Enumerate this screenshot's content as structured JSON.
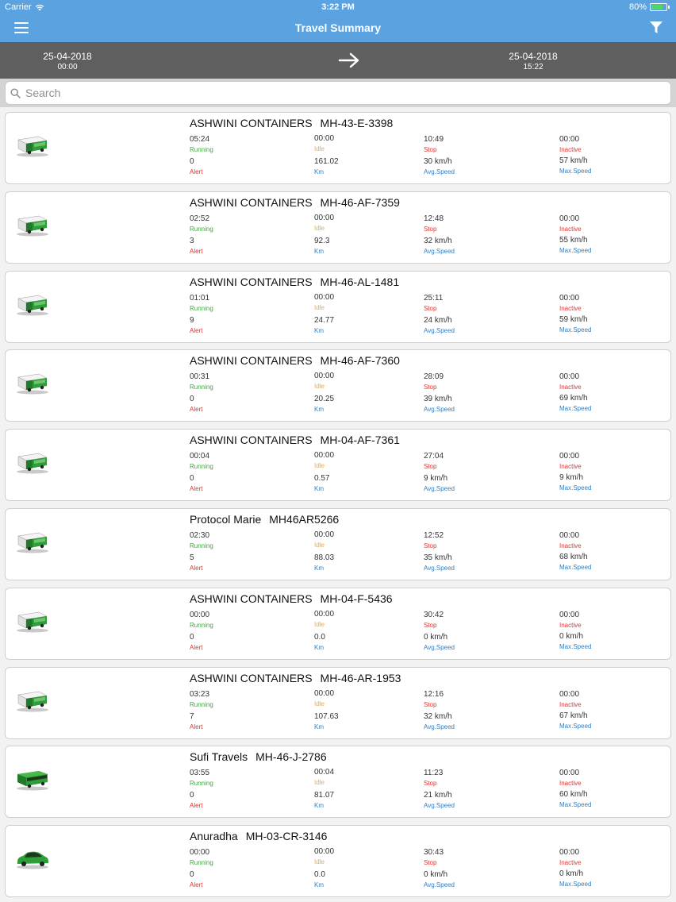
{
  "status": {
    "carrier": "Carrier",
    "time": "3:22 PM",
    "battery": "80%",
    "battery_level": 0.8
  },
  "nav": {
    "title": "Travel Summary",
    "menu_icon": "hamburger-icon",
    "filter_icon": "filter-icon"
  },
  "date_range": {
    "from_date": "25-04-2018",
    "from_time": "00:00",
    "to_date": "25-04-2018",
    "to_time": "15:22"
  },
  "search": {
    "placeholder": "Search"
  },
  "labels": {
    "running": "Running",
    "idle": "Idle",
    "stop": "Stop",
    "inactive": "Inactive",
    "alert": "Alert",
    "km": "Km",
    "avg": "Avg.Speed",
    "max": "Max.Speed"
  },
  "colors": {
    "header": "#5ba3e0",
    "date_bar": "#5f5f5f",
    "running": "#3ea83e",
    "idle": "#f0a92e",
    "stop": "#e3342f",
    "info": "#2e7fc5"
  },
  "vehicles": [
    {
      "name": "ASHWINI CONTAINERS",
      "reg": "MH-43-E-3398",
      "type": "truck",
      "running": "05:24",
      "idle": "00:00",
      "stop": "10:49",
      "inactive": "00:00",
      "alert": "0",
      "km": "161.02",
      "avg": "30 km/h",
      "max": "57 km/h"
    },
    {
      "name": "ASHWINI CONTAINERS",
      "reg": "MH-46-AF-7359",
      "type": "truck",
      "running": "02:52",
      "idle": "00:00",
      "stop": "12:48",
      "inactive": "00:00",
      "alert": "3",
      "km": "92.3",
      "avg": "32 km/h",
      "max": "55 km/h"
    },
    {
      "name": "ASHWINI CONTAINERS",
      "reg": "MH-46-AL-1481",
      "type": "truck",
      "running": "01:01",
      "idle": "00:00",
      "stop": "25:11",
      "inactive": "00:00",
      "alert": "9",
      "km": "24.77",
      "avg": "24 km/h",
      "max": "59 km/h"
    },
    {
      "name": "ASHWINI CONTAINERS",
      "reg": "MH-46-AF-7360",
      "type": "truck",
      "running": "00:31",
      "idle": "00:00",
      "stop": "28:09",
      "inactive": "00:00",
      "alert": "0",
      "km": "20.25",
      "avg": "39 km/h",
      "max": "69 km/h"
    },
    {
      "name": "ASHWINI CONTAINERS",
      "reg": "MH-04-AF-7361",
      "type": "truck",
      "running": "00:04",
      "idle": "00:00",
      "stop": "27:04",
      "inactive": "00:00",
      "alert": "0",
      "km": "0.57",
      "avg": "9 km/h",
      "max": "9 km/h"
    },
    {
      "name": "Protocol Marie",
      "reg": "MH46AR5266",
      "type": "truck",
      "running": "02:30",
      "idle": "00:00",
      "stop": "12:52",
      "inactive": "00:00",
      "alert": "5",
      "km": "88.03",
      "avg": "35 km/h",
      "max": "68 km/h"
    },
    {
      "name": "ASHWINI CONTAINERS",
      "reg": "MH-04-F-5436",
      "type": "truck",
      "running": "00:00",
      "idle": "00:00",
      "stop": "30:42",
      "inactive": "00:00",
      "alert": "0",
      "km": "0.0",
      "avg": "0 km/h",
      "max": "0 km/h"
    },
    {
      "name": "ASHWINI CONTAINERS",
      "reg": "MH-46-AR-1953",
      "type": "truck",
      "running": "03:23",
      "idle": "00:00",
      "stop": "12:16",
      "inactive": "00:00",
      "alert": "7",
      "km": "107.63",
      "avg": "32 km/h",
      "max": "67 km/h"
    },
    {
      "name": "Sufi Travels",
      "reg": "MH-46-J-2786",
      "type": "bus",
      "running": "03:55",
      "idle": "00:04",
      "stop": "11:23",
      "inactive": "00:00",
      "alert": "0",
      "km": "81.07",
      "avg": "21 km/h",
      "max": "60 km/h"
    },
    {
      "name": "Anuradha",
      "reg": "MH-03-CR-3146",
      "type": "car",
      "running": "00:00",
      "idle": "00:00",
      "stop": "30:43",
      "inactive": "00:00",
      "alert": "0",
      "km": "0.0",
      "avg": "0 km/h",
      "max": "0 km/h"
    }
  ]
}
